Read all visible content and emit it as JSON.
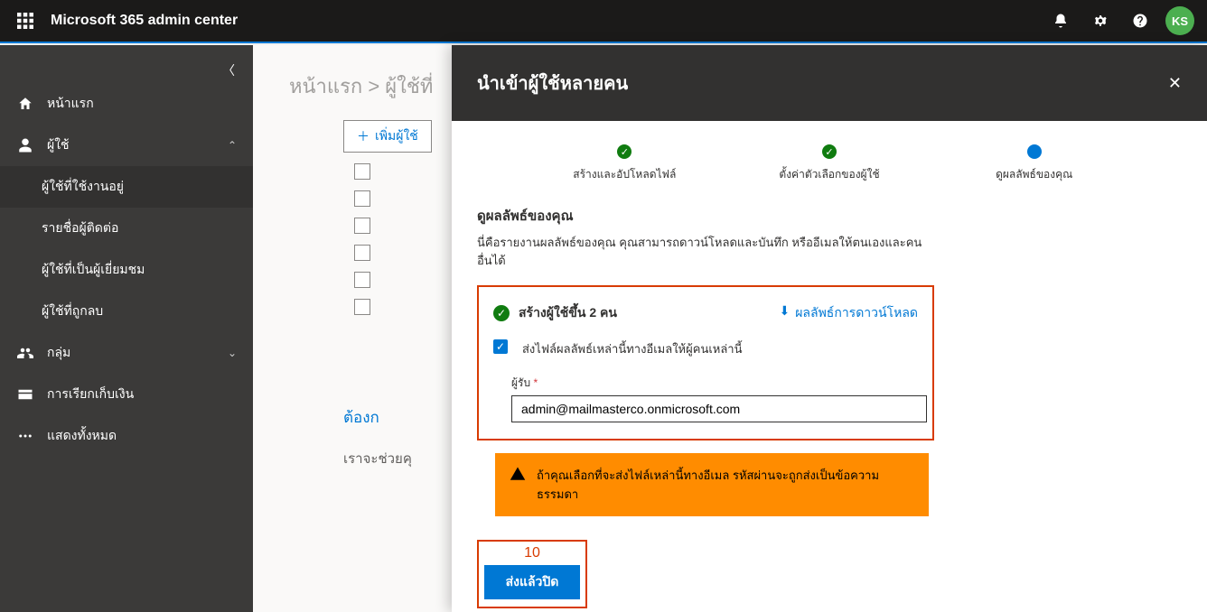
{
  "header": {
    "app_title": "Microsoft 365 admin center",
    "avatar_initials": "KS"
  },
  "nav": {
    "home": "หน้าแรก",
    "users": "ผู้ใช้",
    "users_active": "ผู้ใช้ที่ใช้งานอยู่",
    "users_contacts": "รายชื่อผู้ติดต่อ",
    "users_guests": "ผู้ใช้ที่เป็นผู้เยี่ยมชม",
    "users_deleted": "ผู้ใช้ที่ถูกลบ",
    "groups": "กลุ่ม",
    "billing": "การเรียกเก็บเงิน",
    "show_all": "แสดงทั้งหมด"
  },
  "content": {
    "breadcrumb": "หน้าแรก > ผู้ใช้ที่",
    "add_user": "เพิ่มผู้ใช้",
    "need_label": "ต้องก",
    "help_line": "เราจะช่วยคุ"
  },
  "panel": {
    "title": "นำเข้าผู้ใช้หลายคน",
    "steps": {
      "s1": "สร้างและอัปโหลดไฟล์",
      "s2": "ตั้งค่าตัวเลือกของผู้ใช้",
      "s3": "ดูผลลัพธ์ของคุณ"
    },
    "section_title": "ดูผลลัพธ์ของคุณ",
    "section_desc": "นี่คือรายงานผลลัพธ์ของคุณ คุณสามารถดาวน์โหลดและบันทึก หรืออีเมลให้ตนเองและคนอื่นได้",
    "created_text": "สร้างผู้ใช้ขึ้น 2 คน",
    "download_link": "ผลลัพธ์การดาวน์โหลด",
    "email_checkbox_label": "ส่งไฟล์ผลลัพธ์เหล่านี้ทางอีเมลให้ผู้คนเหล่านี้",
    "recipient_label": "ผู้รับ",
    "recipient_value": "admin@mailmasterco.onmicrosoft.com",
    "warning_text": "ถ้าคุณเลือกที่จะส่งไฟล์เหล่านี้ทางอีเมล รหัสผ่านจะถูกส่งเป็นข้อความธรรมดา",
    "step_number": "10",
    "submit_label": "ส่งแล้วปิด"
  }
}
